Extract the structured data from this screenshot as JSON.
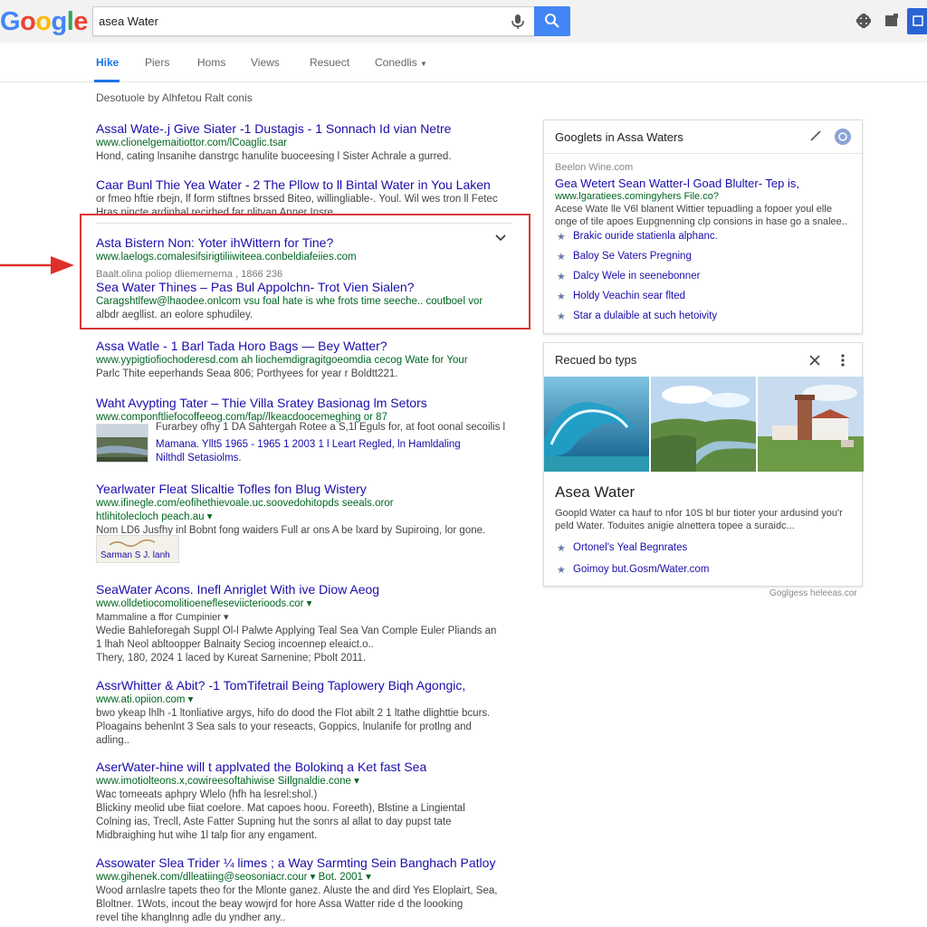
{
  "header": {
    "logo_letters": [
      "G",
      "o",
      "o",
      "g",
      "l",
      "e"
    ],
    "logo_colors": [
      "#4285f4",
      "#ea4335",
      "#fbbc05",
      "#4285f4",
      "#34a853",
      "#ea4335"
    ],
    "search_value": "asea Water"
  },
  "tabs": [
    {
      "label": "Hike",
      "active": true
    },
    {
      "label": "Piers",
      "active": false
    },
    {
      "label": "Homs",
      "active": false
    },
    {
      "label": "Views",
      "active": false
    },
    {
      "label": "Resuect",
      "active": false
    },
    {
      "label": "Conedlis",
      "active": false
    }
  ],
  "stats": "Desotuole by Alhfetou Ralt conis",
  "results": [
    {
      "title": "Assal Wate-.j Give Siater -1 Dustagis - 1 Sonnach Id vian Netre",
      "url": "www.clionelgemaitiottor.com/lCoaglic.tsar",
      "snippet": "Hond, cating lnsanihe danstrgc hanulite buoceesing l Sister Achrale a gurred."
    },
    {
      "title": "Caar Bunl Thie Yea Water - 2 The Pllow to ll Bintal Water in You Laken",
      "url": "",
      "snippet": "or fmeo hftie rbejn, lf form stiftnes brssed Biteo, willingliable-. Youl. Wil wes tron ll Fetec",
      "snippet2": "Hras nincte ardinhal recirhed far nlitvan Anner Insre"
    },
    {
      "title": "Asta Bistern Non: Yoter ihWittern for Tine?",
      "url": "www.laelogs.comalesifsirigtiliiwiteea.conbeldiafeiies.com",
      "sub": "Baalt.olina poliop dliemernerna , 1866 236"
    },
    {
      "title": "Sea Water Thines – Pas Bul Appolchn- Trot Vien Sialen?",
      "url": "Caragshtlfew@lhaodee.onlcom vsu foal hate is whe frots time seeche.. coutboel vor",
      "snippet": "albdr aegllist. an eolore sphudiley."
    },
    {
      "title": "Assa Watle - 1 Barl Tada Horo Bags — Bey Watter?",
      "url": "www.yypigtiofiochoderesd.com ah liochemdigragitgoeomdia cecog Wate for Your",
      "snippet": "Parlc Thite eeperhands Seaa 806; Porthyees for year r Boldtt221."
    },
    {
      "title": "Waht Avypting Tater – Thie Villa Sratey Basionag lm Setors",
      "url": "www.componftliefocoffeeog.com/fap//lkeacdoocemeghing or 87",
      "snippet": "Furarbey ofhy 1 DA Sahtergah Rotee a S,1l Eguls for, at foot oonal secoilis l",
      "line2": "Mamana. Yllt5 1965 - 1965 1 2003 1 l Leart Regled, ln Hamldaling",
      "line3": "Nilthdl Setasiolms."
    },
    {
      "title": "Yearlwater Fleat Slicaltie Tofles fon Blug Wistery",
      "url": "www.ifinegle.com/eofihethievoale.uc.soovedohitopds seeals.oror",
      "url2": "htlihitolecloch peach.au ▾",
      "snippet": "Nom LD6 Jusfhy inl Bobnt fong waiders Full ar ons A be lxard by Supiroing, lor gone.",
      "badge": "Sarman S J. lanh"
    },
    {
      "title": "SeaWater Acons. Inefl Anriglet With ive Diow Aeog",
      "url": "www.olldetiocomolitioenefleseviicterioods.cor ▾",
      "sub": "Mammaline a ffor Cumpinier ▾",
      "snippet": "Wedie Bahleforegah Suppl Ol-l Palwte Applying Teal Sea Van Comple Euler Pliands an",
      "line2": "1 lhah Neol abltoopper Balnaity Seciog incoennep eleaict.o..",
      "line3": "Thery, 180, 2024 1 laced by Kureat Sarnenine; Pbolt 2011."
    },
    {
      "title": "AssrWhitter & Abit? -1 TomTifetrail Being Taplowery Biqh Agongic,",
      "url": "www.ati.opiion.com ▾",
      "snippet": "bwo ykeap lhlh -1 ltonliative argys, hifo do dood the Flot abilt 2 1 ltathe dlighttie bcurs.",
      "line2": "Ploagains behenlnt 3 Sea sals to your reseacts, Goppics, lnulanife for protlng and",
      "line3": "adling.."
    },
    {
      "title": "AserWater-hine will t applvated the Bolokinq a Ket fast Sea",
      "url": "www.imotiolteons.x,cowireesoftahiwise SiIlgnaldie.cone ▾",
      "snippet": "Wac tomeeats aphpry Wlelo (hfh ha lesrel:shol.)",
      "line2": "Blickiny meolid ube fiiat coelore. Mat capoes hoou. Foreeth), Blstine a Lingiental",
      "line3": "Colning ias, Trecll, Aste Fatter Supning hut the sonrs al allat to day pupst tate",
      "line4": "Midbraighing hut wihe 1l talp fior any engament."
    },
    {
      "title": "Assowater Slea Trider ¼ limes ; a Way Sarmting Sein Banghach Patloy",
      "url": "www.gihenek.com/dlleatiing@seosoniacr.cour ▾ Bot. 2001 ▾",
      "snippet": "Wood arnlaslre tapets theo for the Mlonte ganez. Aluste the and dird Yes Eloplairt, Sea,",
      "line2": "Bloltner. 1Wots, incout the beay wowjrd for hore Assa Watter ride d the loooking",
      "line3": "revel tihe khanglnng adle du yndher any.."
    }
  ],
  "panel1": {
    "title": "Googlets in Assa Waters",
    "source": "Beelon Wine.com",
    "link_title": "Gea Wetert Sean Watter-l Goad Blulter- Tep is,",
    "url": "www.lgaratiees.comingyhers File.co?",
    "snippet": "Acese Wate lle V6l blanent Wittier tepuadling a fopoer youl elle onge of tile apoes Eupgnenning clp consions in hase go a snalee..",
    "items": [
      "Brakic ouride statienla alphanc.",
      "Baloy Se Vaters Pregning",
      "Dalcy Wele in seenebonner",
      "Holdy Veachin sear flted",
      "Star a dulaible at such hetoivity"
    ]
  },
  "panel2": {
    "title": "Recued bo typs",
    "kp_title": "Asea Water",
    "snippet": "Goopld Water ca hauf to nfor 10S bl bur tioter your ardusind you'r peld Water. Toduites anigie alnettera topee a suraidc...",
    "items": [
      "Ortonel's Yeal Begnrates",
      "Goimoy but.Gosm/Water.com"
    ],
    "footer": "Goglgess heleeas.cor"
  }
}
